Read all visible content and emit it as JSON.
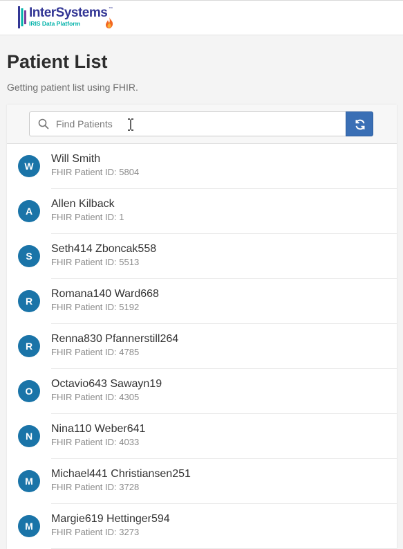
{
  "header": {
    "brand": "InterSystems",
    "brand_tm": "™",
    "product": "IRIS Data Platform",
    "colors": {
      "brand": "#333695",
      "product": "#00b2a9"
    }
  },
  "page": {
    "title": "Patient List",
    "subtitle": "Getting patient list using FHIR."
  },
  "search": {
    "placeholder": "Find Patients",
    "value": "",
    "icon": "search-icon",
    "refresh_icon": "refresh-icon"
  },
  "colors": {
    "avatar": "#1a74a8",
    "refresh_button": "#3a6fb5"
  },
  "patients": [
    {
      "initial": "W",
      "name": "Will Smith",
      "id": "FHIR Patient ID: 5804"
    },
    {
      "initial": "A",
      "name": "Allen Kilback",
      "id": "FHIR Patient ID: 1"
    },
    {
      "initial": "S",
      "name": "Seth414 Zboncak558",
      "id": "FHIR Patient ID: 5513"
    },
    {
      "initial": "R",
      "name": "Romana140 Ward668",
      "id": "FHIR Patient ID: 5192"
    },
    {
      "initial": "R",
      "name": "Renna830 Pfannerstill264",
      "id": "FHIR Patient ID: 4785"
    },
    {
      "initial": "O",
      "name": "Octavio643 Sawayn19",
      "id": "FHIR Patient ID: 4305"
    },
    {
      "initial": "N",
      "name": "Nina110 Weber641",
      "id": "FHIR Patient ID: 4033"
    },
    {
      "initial": "M",
      "name": "Michael441 Christiansen251",
      "id": "FHIR Patient ID: 3728"
    },
    {
      "initial": "M",
      "name": "Margie619 Hettinger594",
      "id": "FHIR Patient ID: 3273"
    }
  ]
}
